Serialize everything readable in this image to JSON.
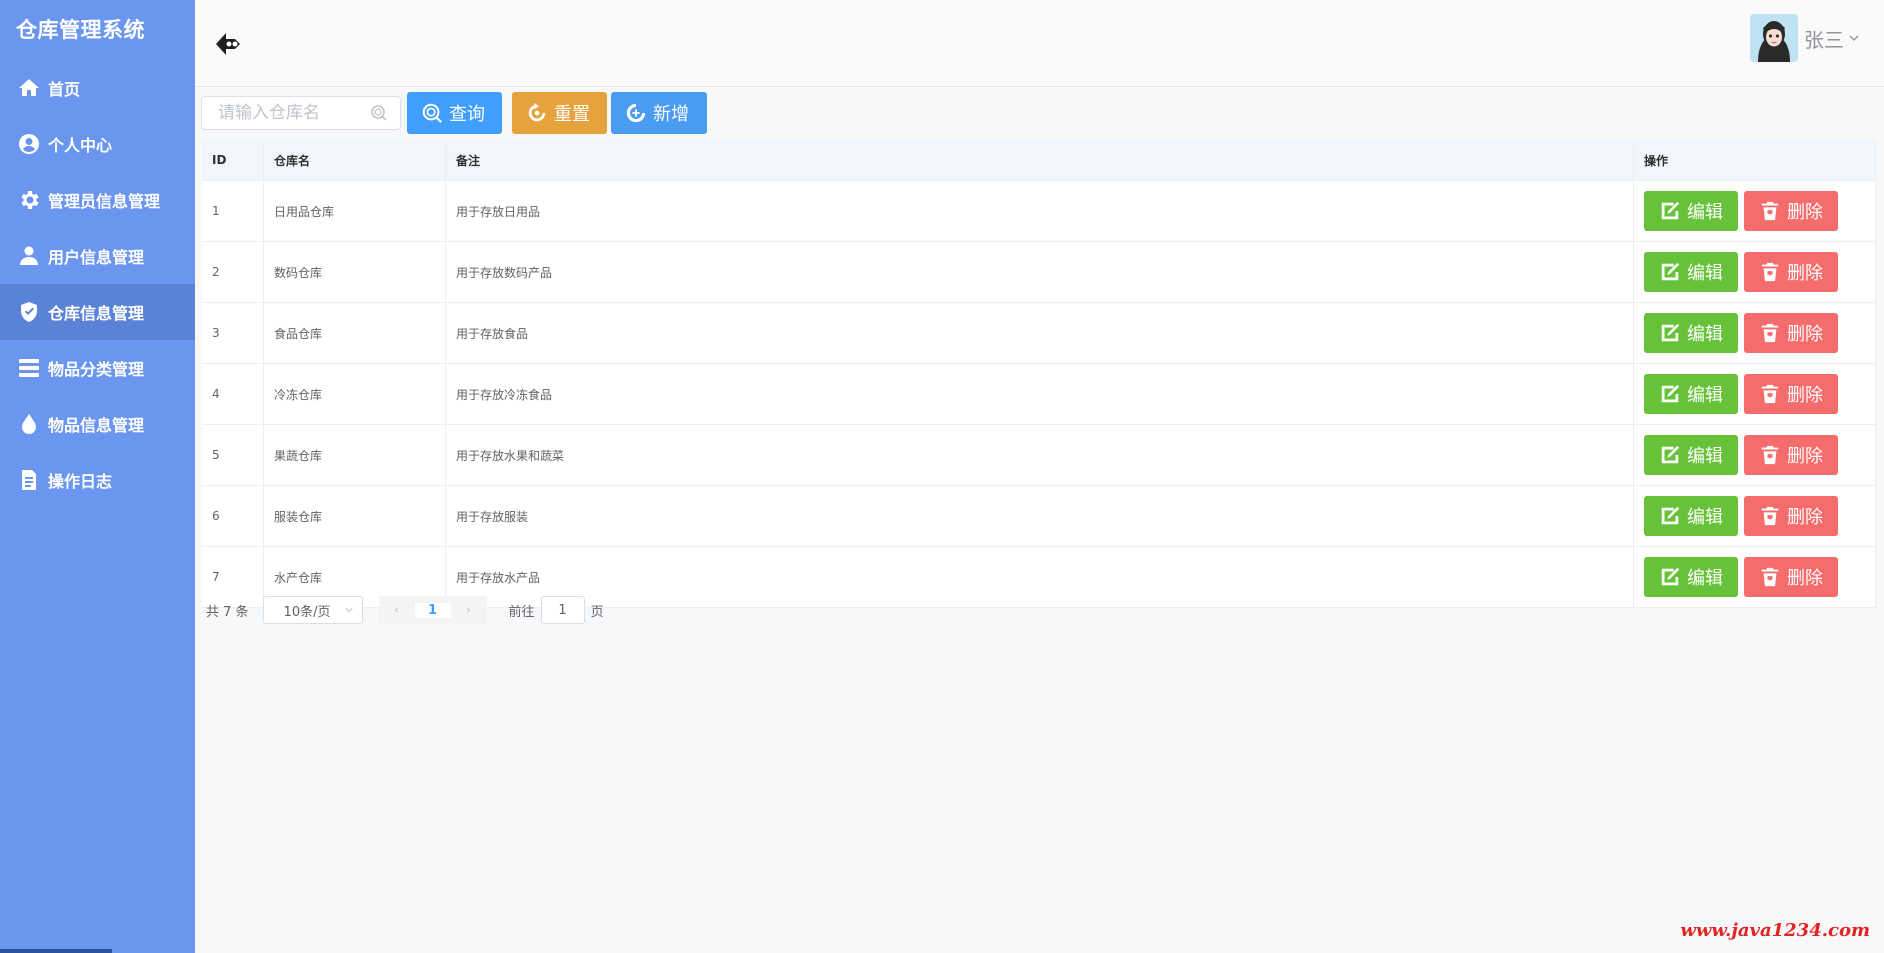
{
  "app": {
    "title": "仓库管理系统"
  },
  "sidebar": {
    "items": [
      {
        "label": "首页",
        "icon": "home-icon"
      },
      {
        "label": "个人中心",
        "icon": "user-circle-icon"
      },
      {
        "label": "管理员信息管理",
        "icon": "gear-icon"
      },
      {
        "label": "用户信息管理",
        "icon": "user-icon"
      },
      {
        "label": "仓库信息管理",
        "icon": "shield-icon",
        "active": true
      },
      {
        "label": "物品分类管理",
        "icon": "list-icon"
      },
      {
        "label": "物品信息管理",
        "icon": "drop-icon"
      },
      {
        "label": "操作日志",
        "icon": "document-icon"
      }
    ]
  },
  "header": {
    "user_name": "张三"
  },
  "toolbar": {
    "search_placeholder": "请输入仓库名",
    "query_label": "查询",
    "reset_label": "重置",
    "add_label": "新增"
  },
  "table": {
    "headers": {
      "id": "ID",
      "name": "仓库名",
      "remark": "备注",
      "op": "操作"
    },
    "rows": [
      {
        "id": "1",
        "name": "日用品仓库",
        "remark": "用于存放日用品"
      },
      {
        "id": "2",
        "name": "数码仓库",
        "remark": "用于存放数码产品"
      },
      {
        "id": "3",
        "name": "食品仓库",
        "remark": "用于存放食品"
      },
      {
        "id": "4",
        "name": "冷冻仓库",
        "remark": "用于存放冷冻食品"
      },
      {
        "id": "5",
        "name": "果蔬仓库",
        "remark": "用于存放水果和蔬菜"
      },
      {
        "id": "6",
        "name": "服装仓库",
        "remark": "用于存放服装"
      },
      {
        "id": "7",
        "name": "水产仓库",
        "remark": "用于存放水产品"
      }
    ],
    "edit_label": "编辑",
    "delete_label": "删除"
  },
  "pagination": {
    "total_text": "共 7 条",
    "page_size": "10条/页",
    "current_page": "1",
    "goto_prefix": "前往",
    "goto_value": "1",
    "goto_suffix": "页"
  },
  "watermark": "www.java1234.com",
  "colors": {
    "sidebar": "#6a96ef",
    "primary": "#409eff",
    "warning": "#e6a23c",
    "success": "#67c23a",
    "danger": "#f56c6c"
  }
}
